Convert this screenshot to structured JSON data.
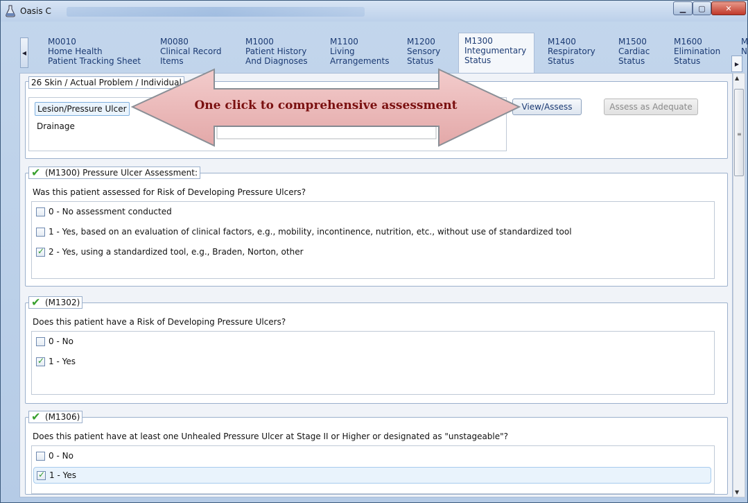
{
  "window": {
    "title": "Oasis C"
  },
  "tabs": [
    {
      "code": "M0010",
      "line1": "Home Health",
      "line2": "Patient Tracking Sheet"
    },
    {
      "code": "M0080",
      "line1": "Clinical Record",
      "line2": "Items"
    },
    {
      "code": "M1000",
      "line1": "Patient History",
      "line2": "And Diagnoses"
    },
    {
      "code": "M1100",
      "line1": "Living",
      "line2": "Arrangements"
    },
    {
      "code": "M1200",
      "line1": "Sensory",
      "line2": "Status"
    },
    {
      "code": "M1300",
      "line1": "Integumentary",
      "line2": "Status"
    },
    {
      "code": "M1400",
      "line1": "Respiratory",
      "line2": "Status"
    },
    {
      "code": "M1500",
      "line1": "Cardiac",
      "line2": "Status"
    },
    {
      "code": "M1600",
      "line1": "Elimination",
      "line2": "Status"
    },
    {
      "code": "M",
      "line1": "N",
      "line2": ""
    }
  ],
  "active_tab": "M1300",
  "problem_group": {
    "legend": "26 Skin / Actual Problem / Individual",
    "items": [
      "Lesion/Pressure Ulcer",
      "Drainage"
    ],
    "view_button": "View/Assess",
    "adequate_button": "Assess as Adequate"
  },
  "callout": {
    "text": "One click to comprehensive assessment"
  },
  "m1300": {
    "legend": "(M1300) Pressure Ulcer Assessment:",
    "question": "Was this patient assessed for Risk of Developing Pressure Ulcers?",
    "options": [
      "0 - No assessment conducted",
      "1 - Yes, based on an evaluation of clinical factors, e.g., mobility, incontinence, nutrition, etc., without use of standardized tool",
      "2 - Yes, using a standardized tool, e.g., Braden, Norton, other"
    ],
    "checked": [
      false,
      false,
      true
    ]
  },
  "m1302": {
    "legend": "(M1302)",
    "question": "Does this patient have a Risk of Developing Pressure Ulcers?",
    "options": [
      "0 - No",
      "1 - Yes"
    ],
    "checked": [
      false,
      true
    ]
  },
  "m1306": {
    "legend": "(M1306)",
    "question": "Does this patient have at least one Unhealed Pressure Ulcer at Stage II or Higher or designated as \"unstageable\"?",
    "options": [
      "0 - No",
      "1 - Yes"
    ],
    "checked": [
      false,
      true
    ]
  },
  "colors": {
    "callout_fill": "#e9b3b3",
    "check_green": "#3aa12f",
    "link_blue": "#1b3a73"
  }
}
